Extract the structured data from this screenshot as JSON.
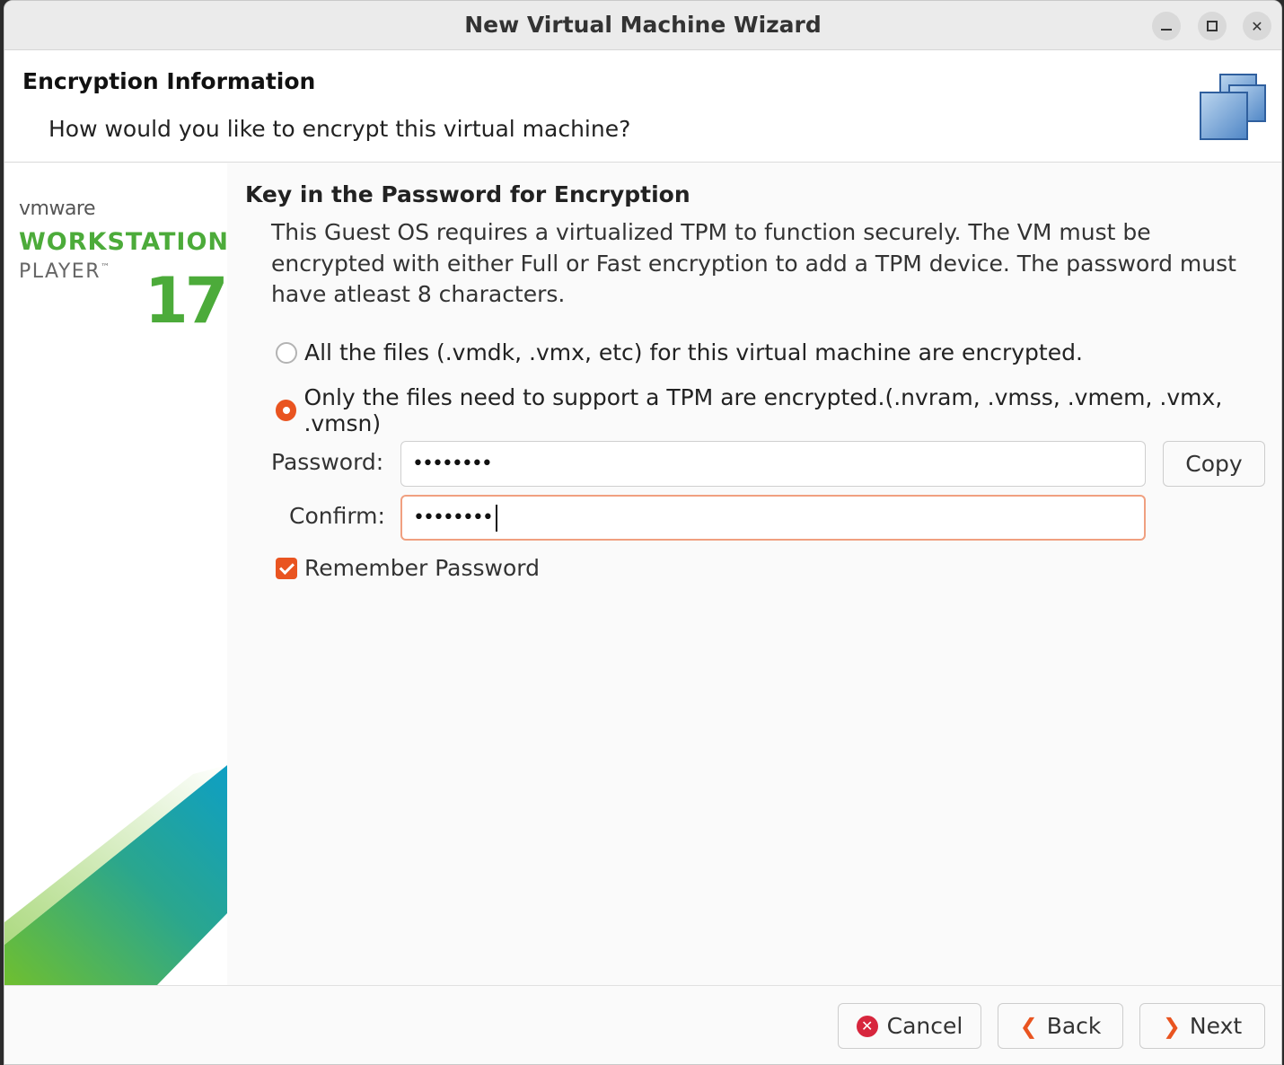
{
  "window": {
    "title": "New Virtual Machine Wizard"
  },
  "header": {
    "title": "Encryption Information",
    "subtitle": "How would you like to encrypt this virtual machine?"
  },
  "sidebar": {
    "brand": "vmware",
    "product_line1": "WORKSTATION",
    "product_line2": "PLAYER",
    "trademark": "™",
    "version": "17"
  },
  "main": {
    "section_title": "Key in the Password for Encryption",
    "description": "This Guest OS requires a virtualized TPM to function securely. The VM must be encrypted with either Full or Fast encryption to add a TPM device. The password must have atleast 8 characters.",
    "options": [
      {
        "label": "All the files (.vmdk, .vmx, etc) for this virtual machine are encrypted.",
        "selected": false
      },
      {
        "label": "Only the files need to support a TPM are encrypted.(.nvram, .vmss, .vmem, .vmx, .vmsn)",
        "selected": true
      }
    ],
    "password_label": "Password:",
    "password_value": "••••••••",
    "confirm_label": "Confirm:",
    "confirm_value": "••••••••",
    "copy_label": "Copy",
    "remember_label": "Remember Password",
    "remember_checked": true
  },
  "footer": {
    "cancel_label": "Cancel",
    "back_label": "Back",
    "next_label": "Next"
  },
  "colors": {
    "accent": "#e95420",
    "brand_green": "#4cab3a",
    "error_red": "#d7263d"
  },
  "icons": [
    "minimize-icon",
    "maximize-icon",
    "close-icon",
    "vm-stack-icon",
    "cancel-x-icon",
    "back-arrow-icon",
    "next-arrow-icon"
  ]
}
